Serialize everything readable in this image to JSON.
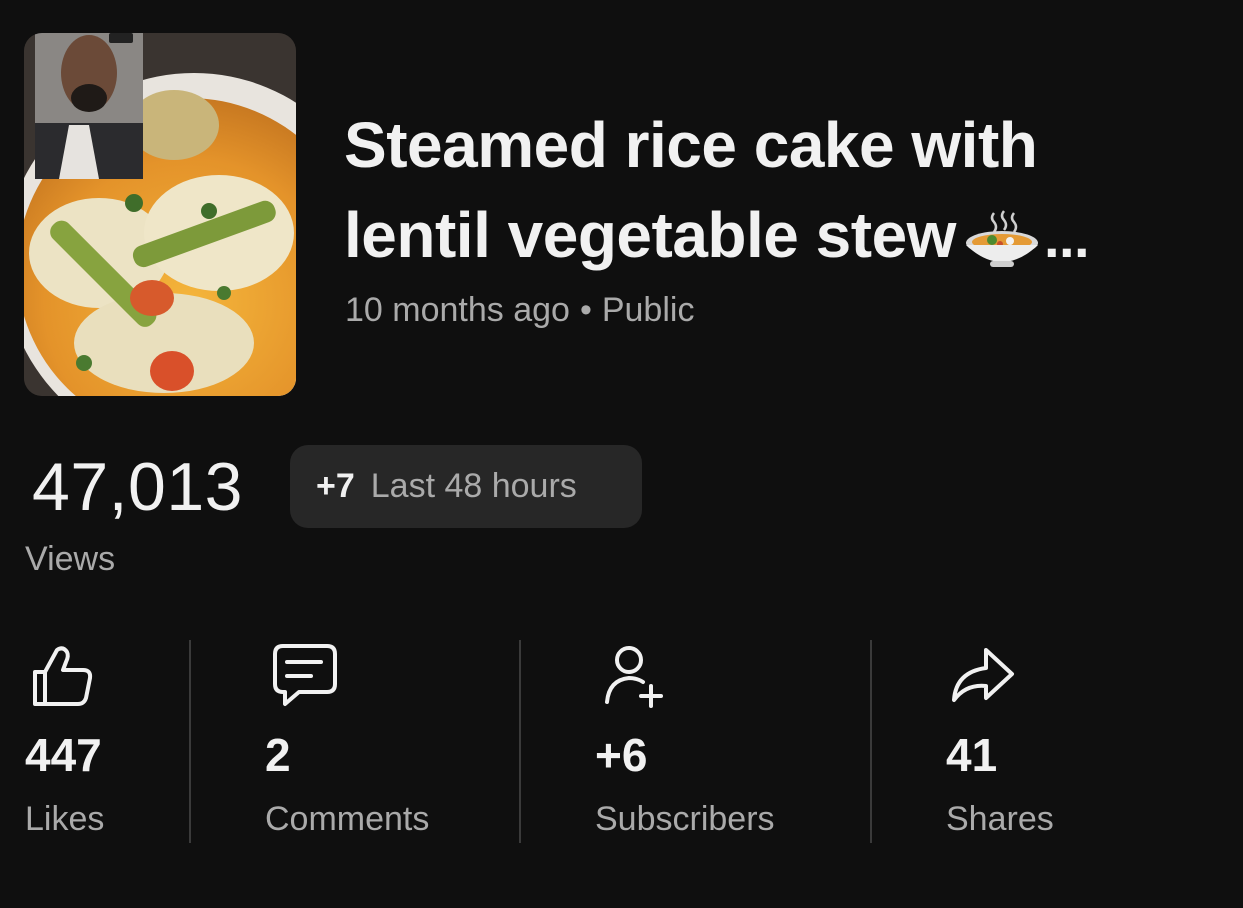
{
  "video": {
    "title_line1": "Steamed rice cake with",
    "title_line2": "lentil vegetable stew",
    "title_ellipsis": "...",
    "age": "10 months ago",
    "separator": "•",
    "visibility": "Public",
    "thumbnail_icon": "food-thumbnail-image",
    "title_emoji_icon": "stew-bowl-emoji"
  },
  "views": {
    "count": "47,013",
    "delta": "+7",
    "period": "Last 48 hours",
    "label": "Views"
  },
  "stats": [
    {
      "icon": "thumbs-up-icon",
      "value": "447",
      "label": "Likes"
    },
    {
      "icon": "comment-icon",
      "value": "2",
      "label": "Comments"
    },
    {
      "icon": "add-person-icon",
      "value": "+6",
      "label": "Subscribers"
    },
    {
      "icon": "share-icon",
      "value": "41",
      "label": "Shares"
    }
  ],
  "colors": {
    "background": "#0f0f0f",
    "text_primary": "#f1f1f1",
    "text_secondary": "#aaaaaa",
    "pill_background": "#272727",
    "divider": "#3a3a3a"
  }
}
